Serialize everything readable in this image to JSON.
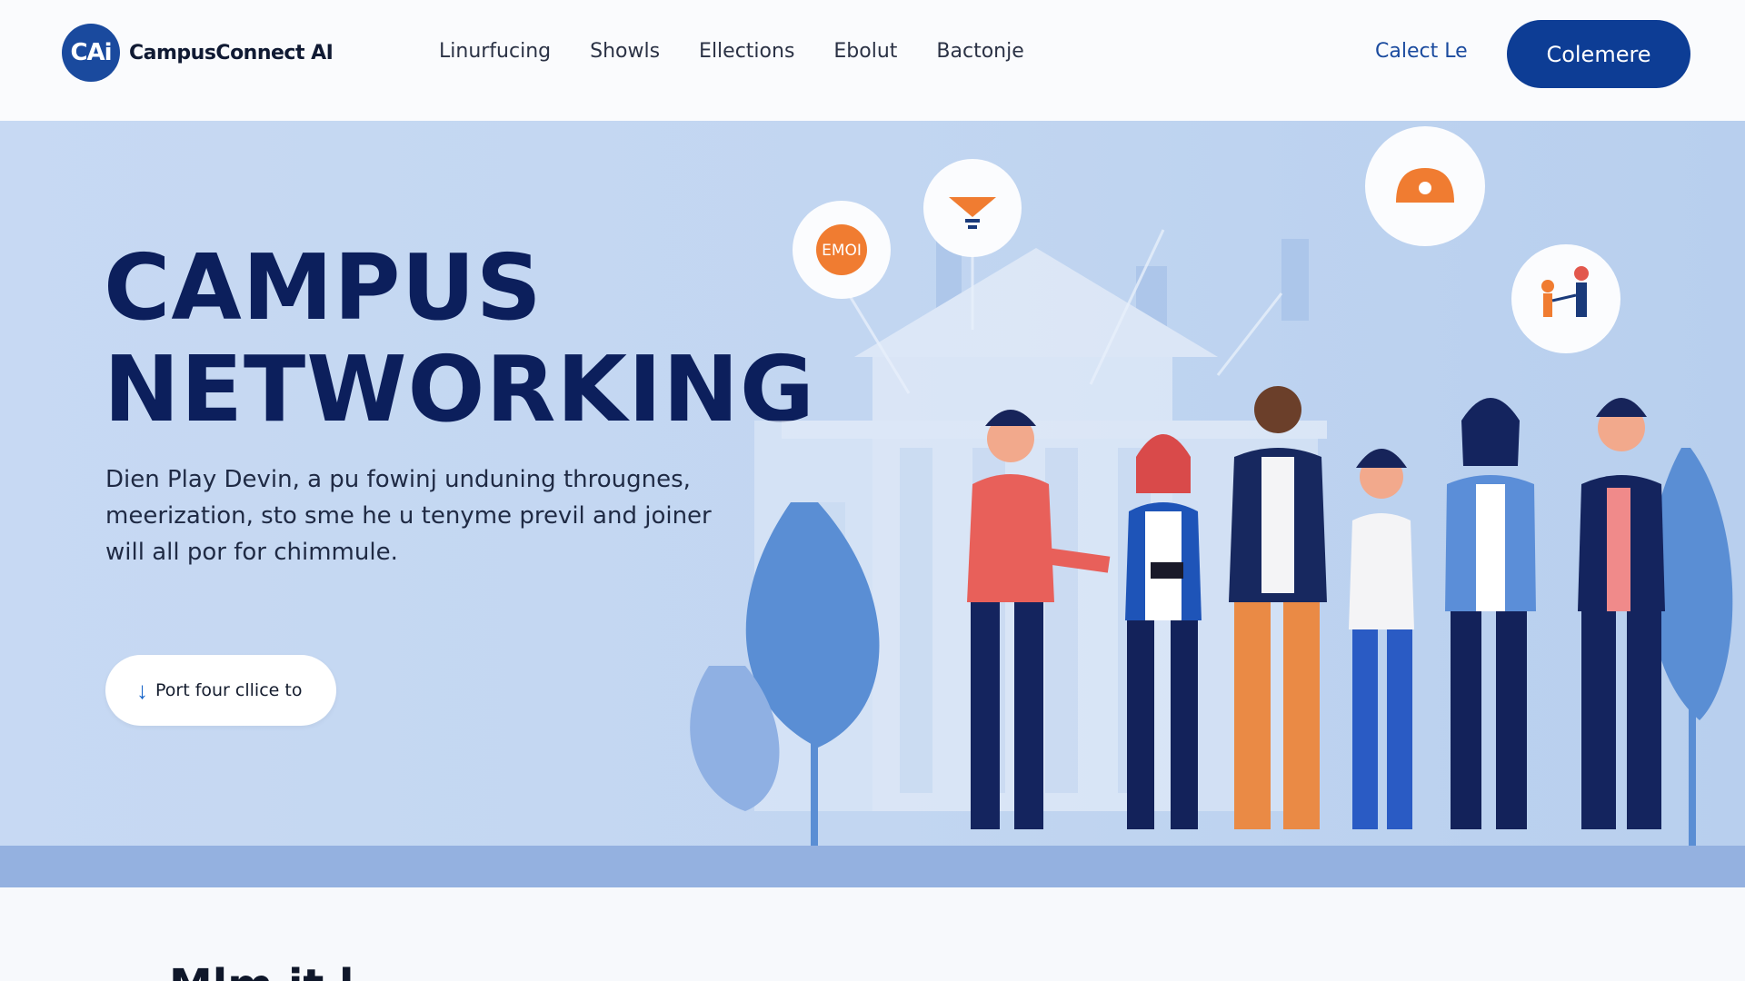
{
  "brand": {
    "logo_initials": "CAi",
    "name": "CampusConnect AI",
    "accent": "#1a4a9e",
    "primary_button_color": "#0d3d95",
    "hero_title_color": "#0c1f5c"
  },
  "nav": {
    "items": [
      "Linurfucing",
      "Showls",
      "Ellections",
      "Ebolut",
      "Bactonje"
    ]
  },
  "header_actions": {
    "login_label": "Calect Le",
    "cta_label": "Colemere"
  },
  "hero": {
    "title_line1": "CAMPUS",
    "title_line2": "NETWORKING",
    "desc_line1": "Dien Play Devin, a pu fowinj unduning througnes,",
    "desc_line2": "meerization, sto sme he u tenyme previl and joiner",
    "desc_line3": "will all por for chimmule.",
    "button_icon": "arrow-down-icon",
    "button_label": "Port four cllice to"
  },
  "illustration": {
    "bubbles": [
      {
        "icon": "emoji-badge-icon",
        "label": "EMOI"
      },
      {
        "icon": "funnel-icon"
      },
      {
        "icon": "location-pin-icon"
      },
      {
        "icon": "people-handshake-icon"
      }
    ]
  },
  "bottom": {
    "heading": "Mlm it l"
  }
}
